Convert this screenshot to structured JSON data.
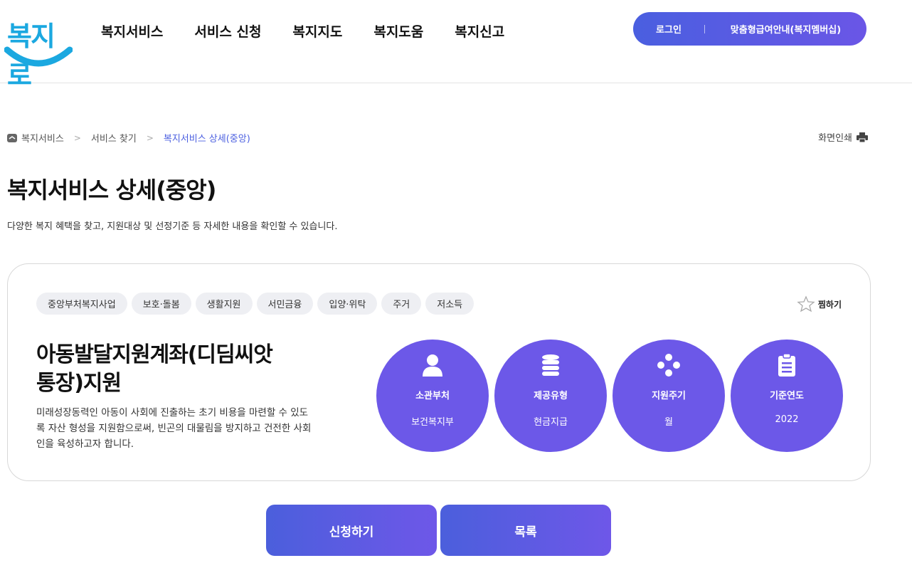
{
  "header": {
    "logo_text": "복지로",
    "nav": [
      "복지서비스",
      "서비스 신청",
      "복지지도",
      "복지도움",
      "복지신고"
    ],
    "login_label": "로그인",
    "membership_label": "맞춤형급여안내(복지멤버십)"
  },
  "breadcrumb": {
    "items": [
      "복지서비스",
      "서비스 찾기",
      "복지서비스 상세(중앙)"
    ],
    "print_label": "화면인쇄"
  },
  "page": {
    "title": "복지서비스 상세(중앙)",
    "description": "다양한 복지 혜택을 찾고, 지원대상 및 선정기준 등 자세한 내용을 확인할 수 있습니다."
  },
  "service": {
    "tags": [
      "중앙부처복지사업",
      "보호·돌봄",
      "생활지원",
      "서민금융",
      "입양·위탁",
      "주거",
      "저소득"
    ],
    "favorite_label": "찜하기",
    "title_line1": "아동발달지원계좌(디딤씨앗",
    "title_line2": "통장)지원",
    "description": "미래성장동력인 아동이 사회에 진출하는 초기 비용을 마련할 수 있도록 자산 형성을 지원함으로써, 빈곤의 대물림을 방지하고 건전한 사회인을 육성하고자 합니다.",
    "info": [
      {
        "label": "소관부처",
        "value": "보건복지부",
        "icon": "person-icon"
      },
      {
        "label": "제공유형",
        "value": "현금지급",
        "icon": "coins-icon"
      },
      {
        "label": "지원주기",
        "value": "월",
        "icon": "cycle-icon"
      },
      {
        "label": "기준연도",
        "value": "2022",
        "icon": "clipboard-icon"
      }
    ]
  },
  "actions": {
    "apply_label": "신청하기",
    "list_label": "목록"
  },
  "colors": {
    "accent": "#6c58e8",
    "accent_blue": "#4b5fe0",
    "logo_blue": "#1ba8e0"
  }
}
